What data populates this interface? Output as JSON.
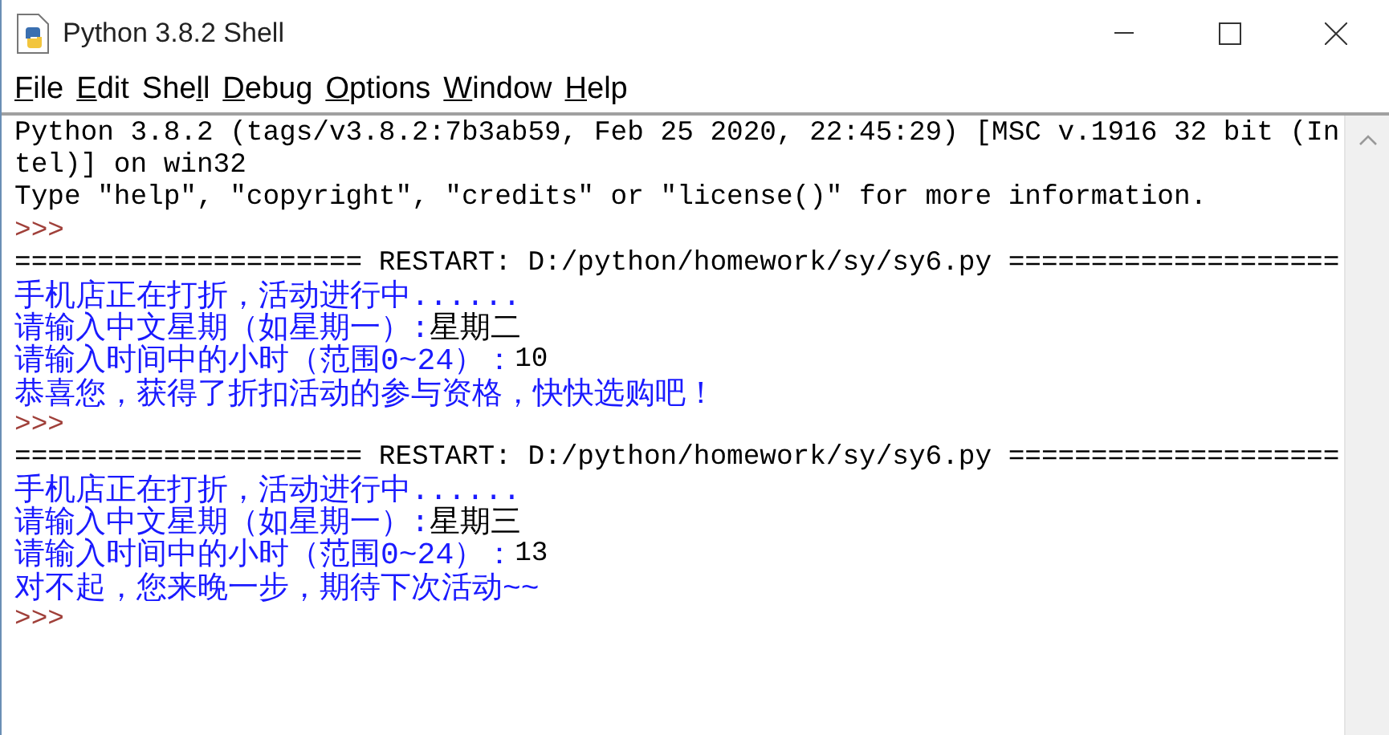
{
  "window": {
    "title": "Python 3.8.2 Shell"
  },
  "menu": [
    {
      "parts": [
        {
          "text": "F",
          "underlined": true
        },
        {
          "text": "ile",
          "underlined": false
        }
      ]
    },
    {
      "parts": [
        {
          "text": "E",
          "underlined": true
        },
        {
          "text": "dit",
          "underlined": false
        }
      ]
    },
    {
      "parts": [
        {
          "text": "She",
          "underlined": false
        },
        {
          "text": "l",
          "underlined": true
        },
        {
          "text": "l",
          "underlined": false
        }
      ]
    },
    {
      "parts": [
        {
          "text": "D",
          "underlined": true
        },
        {
          "text": "ebug",
          "underlined": false
        }
      ]
    },
    {
      "parts": [
        {
          "text": "O",
          "underlined": true
        },
        {
          "text": "ptions",
          "underlined": false
        }
      ]
    },
    {
      "parts": [
        {
          "text": "W",
          "underlined": true
        },
        {
          "text": "indow",
          "underlined": false
        }
      ]
    },
    {
      "parts": [
        {
          "text": "H",
          "underlined": true
        },
        {
          "text": "elp",
          "underlined": false
        }
      ]
    }
  ],
  "lines": [
    [
      {
        "kind": "console",
        "text": "Python 3.8.2 (tags/v3.8.2:7b3ab59, Feb 25 2020, 22:45:29) [MSC v.1916 32 bit (In"
      }
    ],
    [
      {
        "kind": "console",
        "text": "tel)] on win32"
      }
    ],
    [
      {
        "kind": "console",
        "text": "Type \"help\", \"copyright\", \"credits\" or \"license()\" for more information."
      }
    ],
    [
      {
        "kind": "prompt",
        "text": ">>>"
      }
    ],
    [
      {
        "kind": "console",
        "text": "===================== RESTART: D:/python/homework/sy/sy6.py ===================="
      }
    ],
    [
      {
        "kind": "output",
        "text": "手机店正在打折，活动进行中......"
      }
    ],
    [
      {
        "kind": "output",
        "text": "请输入中文星期（如星期一）:"
      },
      {
        "kind": "input",
        "text": "星期二"
      }
    ],
    [
      {
        "kind": "output",
        "text": "请输入时间中的小时（范围0~24）："
      },
      {
        "kind": "input",
        "text": "10"
      }
    ],
    [
      {
        "kind": "output",
        "text": "恭喜您，获得了折扣活动的参与资格，快快选购吧！"
      }
    ],
    [
      {
        "kind": "prompt",
        "text": ">>>"
      }
    ],
    [
      {
        "kind": "console",
        "text": "===================== RESTART: D:/python/homework/sy/sy6.py ===================="
      }
    ],
    [
      {
        "kind": "output",
        "text": "手机店正在打折，活动进行中......"
      }
    ],
    [
      {
        "kind": "output",
        "text": "请输入中文星期（如星期一）:"
      },
      {
        "kind": "input",
        "text": "星期三"
      }
    ],
    [
      {
        "kind": "output",
        "text": "请输入时间中的小时（范围0~24）："
      },
      {
        "kind": "input",
        "text": "13"
      }
    ],
    [
      {
        "kind": "output",
        "text": "对不起，您来晚一步，期待下次活动~~"
      }
    ],
    [
      {
        "kind": "prompt",
        "text": ">>>"
      }
    ]
  ]
}
